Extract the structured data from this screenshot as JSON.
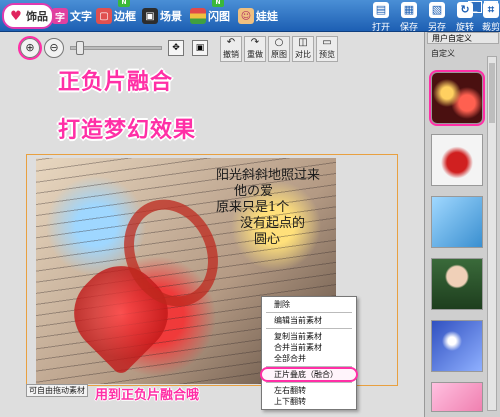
{
  "tabs": [
    {
      "label": "饰品",
      "icon": "heart-icon",
      "new": false
    },
    {
      "label": "文字",
      "icon": "text-icon",
      "new": false
    },
    {
      "label": "边框",
      "icon": "frame-icon",
      "new": true
    },
    {
      "label": "场景",
      "icon": "scene-icon",
      "new": false
    },
    {
      "label": "闪图",
      "icon": "flash-icon",
      "new": true
    },
    {
      "label": "娃娃",
      "icon": "doll-icon",
      "new": false
    }
  ],
  "right_buttons": [
    {
      "label": "打开",
      "icon": "open-icon"
    },
    {
      "label": "保存",
      "icon": "save-icon"
    },
    {
      "label": "另存",
      "icon": "save-as-icon"
    },
    {
      "label": "旋转",
      "icon": "rotate-icon"
    },
    {
      "label": "裁剪",
      "icon": "crop-icon"
    }
  ],
  "toolbar": {
    "undo": "撤销",
    "redo": "重做",
    "original": "原图",
    "compare": "对比",
    "preview": "预览"
  },
  "headline_1": "正负片融合",
  "headline_2": "打造梦幻效果",
  "poem": [
    "阳光斜斜地照过来",
    "他の爱",
    "原来只是1个",
    "没有起点的",
    "圆心"
  ],
  "hint": "可自由拖动素材",
  "annotation": "用到正负片融合哦",
  "context_menu": {
    "items": [
      "删除",
      "编辑当前素材",
      "复制当前素材",
      "合并当前素材",
      "全部合并",
      "正片叠底（融合）",
      "左右翻转",
      "上下翻转"
    ],
    "highlighted_index": 5
  },
  "panel": {
    "tab": "用户自定义",
    "label": "自定义"
  },
  "colors": {
    "accent": "#ff2fa6",
    "topbar": "#1d5fb3"
  }
}
